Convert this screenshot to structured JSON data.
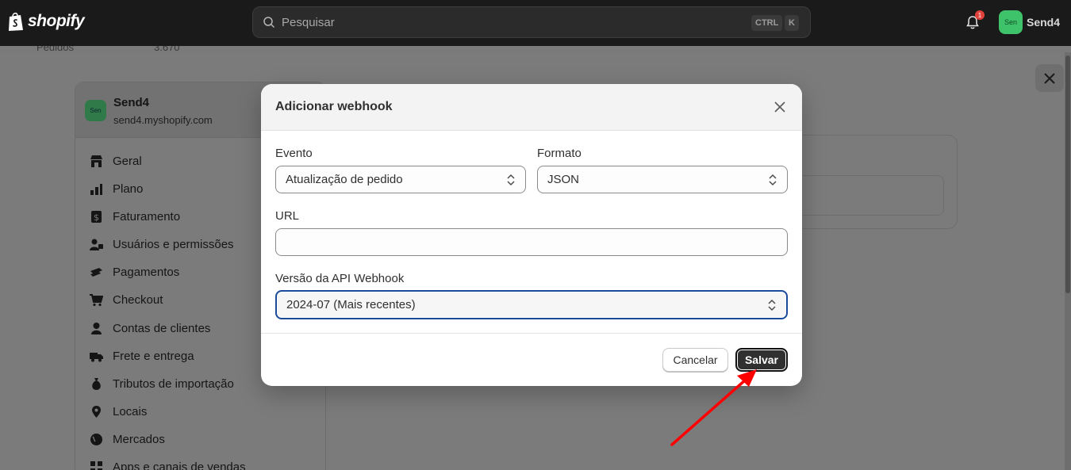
{
  "topbar": {
    "brand": "shopify",
    "search_placeholder": "Pesquisar",
    "shortcut_ctrl": "CTRL",
    "shortcut_key": "K",
    "notification_count": "1",
    "avatar_initials": "Sen",
    "store_name": "Send4"
  },
  "background": {
    "peek_label": "Pedidos",
    "peek_value": "3.670"
  },
  "sidebar": {
    "avatar_initials": "Sen",
    "store_name": "Send4",
    "store_domain": "send4.myshopify.com",
    "items": [
      {
        "label": "Geral",
        "icon": "store-icon"
      },
      {
        "label": "Plano",
        "icon": "plan-icon"
      },
      {
        "label": "Faturamento",
        "icon": "billing-icon"
      },
      {
        "label": "Usuários e permissões",
        "icon": "users-icon"
      },
      {
        "label": "Pagamentos",
        "icon": "payments-icon"
      },
      {
        "label": "Checkout",
        "icon": "cart-icon"
      },
      {
        "label": "Contas de clientes",
        "icon": "person-icon"
      },
      {
        "label": "Frete e entrega",
        "icon": "truck-icon"
      },
      {
        "label": "Tributos de importação",
        "icon": "money-bag-icon"
      },
      {
        "label": "Locais",
        "icon": "location-icon"
      },
      {
        "label": "Mercados",
        "icon": "globe-icon"
      },
      {
        "label": "Apps e canais de vendas",
        "icon": "apps-icon"
      }
    ]
  },
  "modal": {
    "title": "Adicionar webhook",
    "event_label": "Evento",
    "event_value": "Atualização de pedido",
    "format_label": "Formato",
    "format_value": "JSON",
    "url_label": "URL",
    "url_value": "",
    "api_version_label": "Versão da API Webhook",
    "api_version_value": "2024-07 (Mais recentes)",
    "cancel_label": "Cancelar",
    "save_label": "Salvar"
  },
  "colors": {
    "annotation_arrow": "#ff0000",
    "primary_button": "#303030",
    "focus_ring": "#1a4a9a"
  }
}
